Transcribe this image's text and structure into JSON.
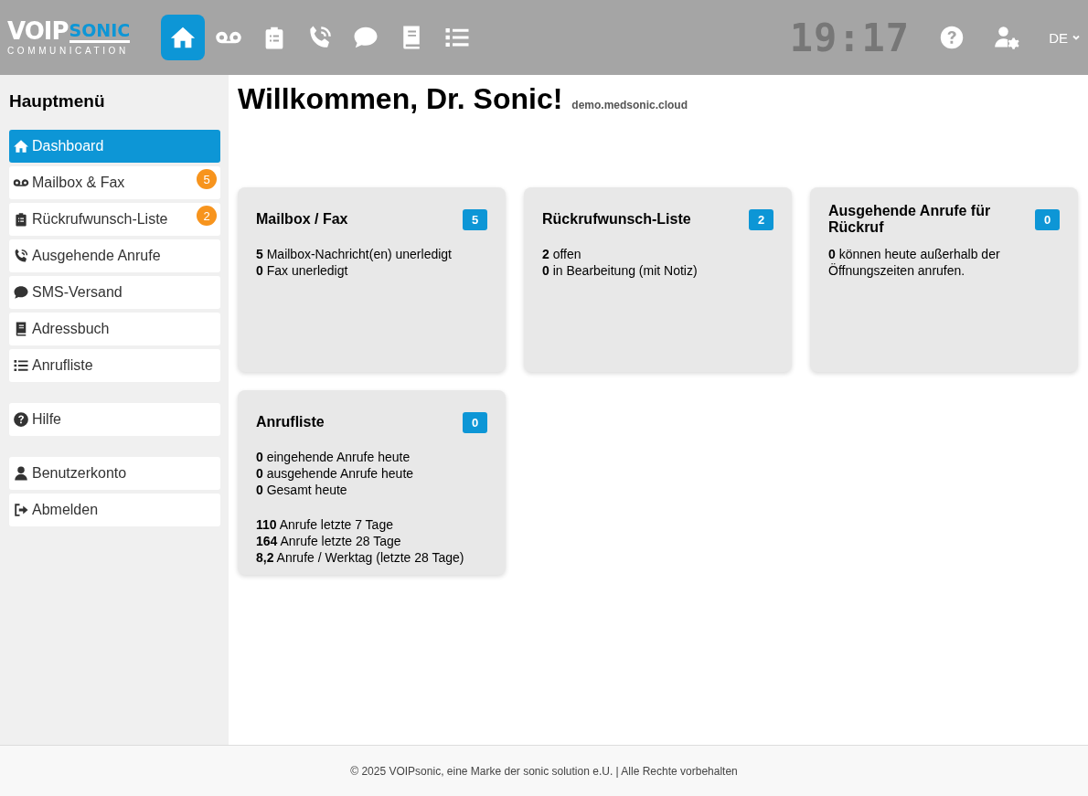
{
  "header": {
    "logo": {
      "word_1": "VOIP",
      "word_2": "SONIC",
      "tagline": "COMMUNICATION"
    },
    "nav": [
      {
        "selected": true
      },
      {
        "selected": false
      },
      {
        "selected": false
      },
      {
        "selected": false
      },
      {
        "selected": false
      },
      {
        "selected": false
      },
      {
        "selected": false
      }
    ],
    "clock": "19:17",
    "language": "DE"
  },
  "sidebar": {
    "title": "Hauptmenü",
    "groups": [
      [
        {
          "label": "Dashboard",
          "selected": true
        },
        {
          "label": "Mailbox & Fax",
          "selected": false,
          "badge": "5"
        },
        {
          "label": "Rückrufwunsch-Liste",
          "selected": false,
          "badge": "2"
        },
        {
          "label": "Ausgehende Anrufe",
          "selected": false
        },
        {
          "label": "SMS-Versand",
          "selected": false
        },
        {
          "label": "Adressbuch",
          "selected": false
        },
        {
          "label": "Anrufliste",
          "selected": false
        }
      ],
      [
        {
          "label": "Hilfe",
          "selected": false
        }
      ],
      [
        {
          "label": "Benutzerkonto",
          "selected": false
        },
        {
          "label": "Abmelden",
          "selected": false
        }
      ]
    ]
  },
  "main": {
    "title": "Willkommen, Dr. Sonic!",
    "domain": "demo.medsonic.cloud",
    "cards": [
      {
        "title": "Mailbox / Fax",
        "count": "5",
        "groups": [
          [
            "**5** Mailbox-Nachricht(en) unerledigt",
            "**0** Fax unerledigt"
          ]
        ]
      },
      {
        "title": "Rückrufwunsch-Liste",
        "count": "2",
        "groups": [
          [
            "**2** offen",
            "**0** in Bearbeitung (mit Notiz)"
          ]
        ]
      },
      {
        "title": "Ausgehende Anrufe für Rückruf",
        "count": "0",
        "groups": [
          [
            "**0** können heute außerhalb der Öffnungszeiten anrufen."
          ]
        ]
      },
      {
        "title": "Anrufliste",
        "count": "0",
        "groups": [
          [
            "**0** eingehende Anrufe heute",
            "**0** ausgehende Anrufe heute",
            "**0** Gesamt heute"
          ],
          [
            "**110** Anrufe letzte 7 Tage",
            "**164** Anrufe letzte 28 Tage",
            "**8,2** Anrufe / Werktag (letzte 28 Tage)"
          ]
        ]
      }
    ]
  },
  "footer": "© 2025 VOIPsonic, eine Marke der sonic solution e.U. | Alle Rechte vorbehalten"
}
